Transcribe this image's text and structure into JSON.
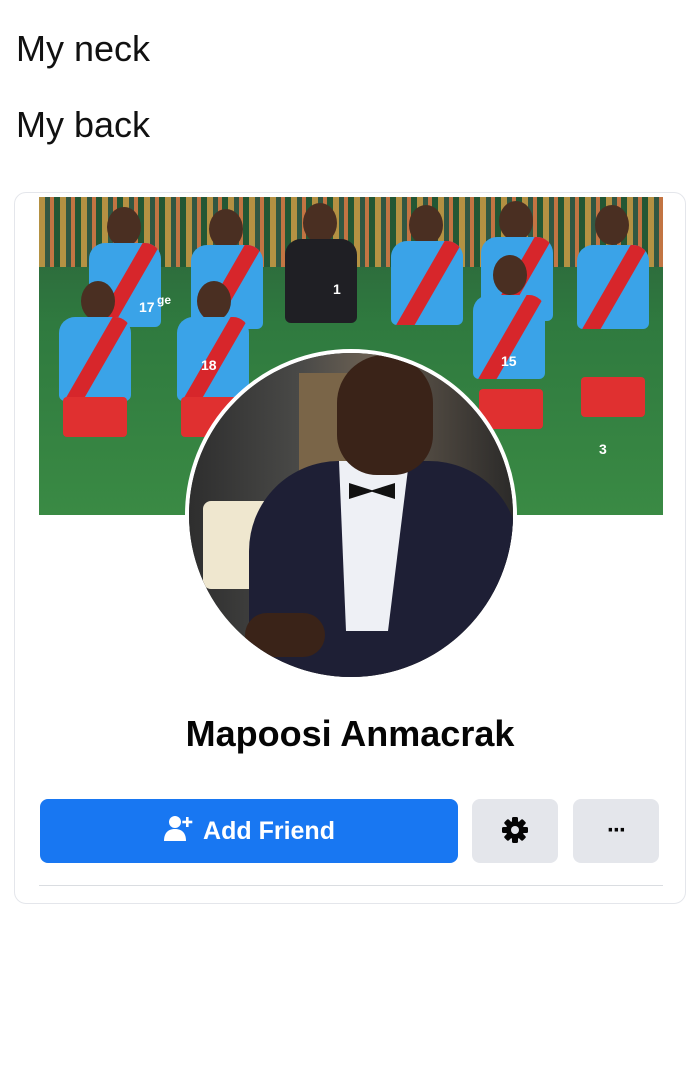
{
  "caption": {
    "line1": "My neck",
    "line2": "My back"
  },
  "profile": {
    "name": "Mapoosi Anmacrak",
    "cover_jersey_numbers": [
      "17",
      "18",
      "1",
      "15",
      "3"
    ],
    "cover_text_fragment": "ge"
  },
  "actions": {
    "add_friend_label": "Add Friend",
    "add_friend_icon": "person-add-icon",
    "settings_icon": "gear-icon",
    "more_icon": "more-dots-icon",
    "more_glyph": "···"
  },
  "colors": {
    "accent": "#1877f2",
    "secondary_button": "#e4e6eb",
    "name_text": "#050505"
  }
}
